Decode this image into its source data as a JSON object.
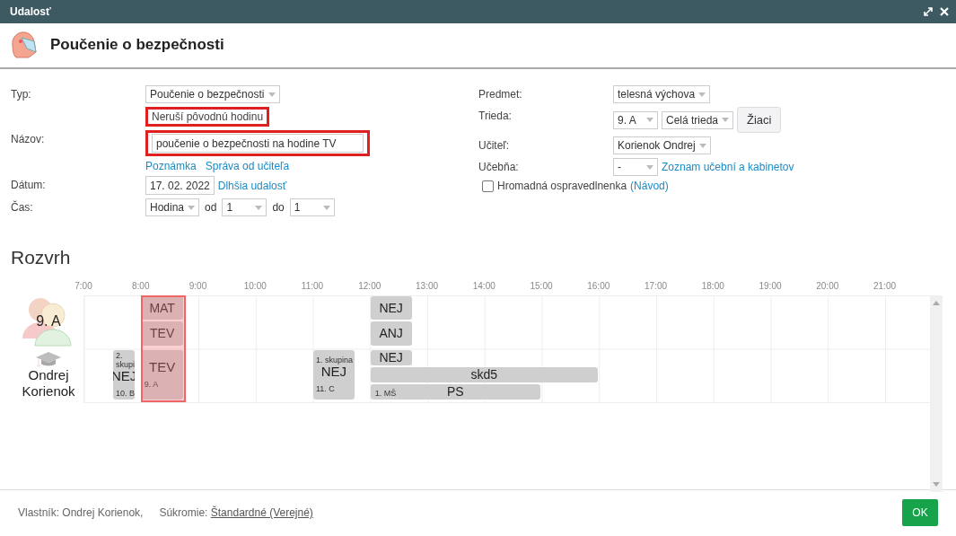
{
  "window": {
    "title": "Udalosť"
  },
  "header": {
    "title": "Poučenie o bezpečnosti"
  },
  "form_left": {
    "type": {
      "label": "Typ:",
      "value": "Poučenie o bezpečnosti",
      "note": "Neruší pôvodnú hodinu"
    },
    "name": {
      "label": "Názov:",
      "value": "poučenie o bezpečnosti na hodine TV",
      "links": [
        "Poznámka",
        "Správa od učiteľa"
      ]
    },
    "date": {
      "label": "Dátum:",
      "value": "17. 02. 2022",
      "link": "Dlhšia udalosť"
    },
    "time": {
      "label": "Čas:",
      "mode": "Hodina",
      "from_label": "od",
      "from": "1",
      "to_label": "do",
      "to": "1"
    }
  },
  "form_right": {
    "subject": {
      "label": "Predmet:",
      "value": "telesná výchova"
    },
    "class": {
      "label": "Trieda:",
      "value": "9. A",
      "group": "Celá trieda",
      "button": "Žiaci"
    },
    "teacher": {
      "label": "Učiteľ:",
      "value": "Korienok Ondrej"
    },
    "room": {
      "label": "Učebňa:",
      "value": "-",
      "link": "Zoznam učební a kabinetov"
    },
    "mass_excuse": {
      "label": "Hromadná ospravedlnenka",
      "checked": false,
      "link": "(Návod)"
    }
  },
  "schedule": {
    "title": "Rozvrh",
    "hours": [
      "7:00",
      "8:00",
      "9:00",
      "10:00",
      "11:00",
      "12:00",
      "13:00",
      "14:00",
      "15:00",
      "16:00",
      "17:00",
      "18:00",
      "19:00",
      "20:00",
      "21:00"
    ],
    "rows": [
      {
        "label": "9. A",
        "kind": "class",
        "blocks": [
          {
            "title": "MAT"
          },
          {
            "title": "TEV"
          },
          {
            "title": "NEJ"
          },
          {
            "title": "ANJ"
          }
        ]
      },
      {
        "label": "Ondrej Korienok",
        "kind": "teacher",
        "blocks": [
          {
            "top": "2. skupi",
            "title": "NEJ",
            "bottom": "10. B"
          },
          {
            "title": "TEV",
            "bottom": "9. A"
          },
          {
            "top": "1. skupina",
            "title": "NEJ",
            "bottom": "11. C"
          },
          {
            "title": "NEJ"
          },
          {
            "title": "skd5"
          },
          {
            "title": "PS",
            "bottom": "1. MŠ"
          }
        ]
      }
    ]
  },
  "footer": {
    "owner": "Vlastník: Ondrej Korienok,",
    "privacy_label": "Súkromie:",
    "privacy_value": "Štandardné (Verejné)",
    "ok": "OK"
  }
}
